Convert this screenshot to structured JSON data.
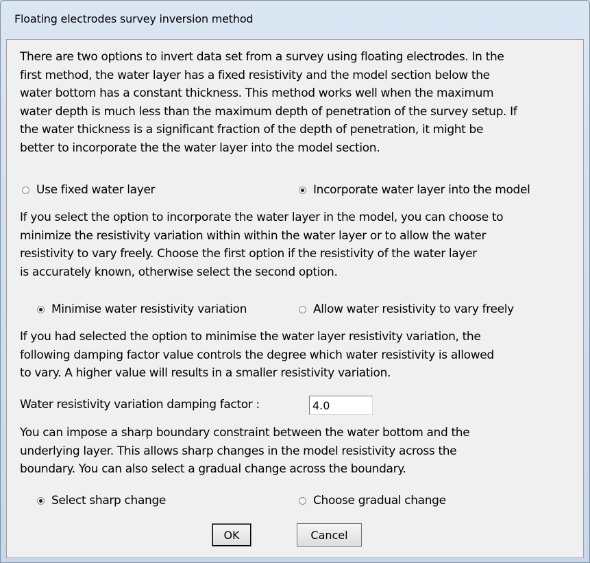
{
  "window": {
    "title": "Floating electrodes survey inversion method"
  },
  "section1": {
    "text": "There are two options to invert data set from a survey using floating electrodes. In the\nfirst method, the water layer has a fixed resistivity and the model section below the\nwater bottom has a constant thickness. This method works well when the maximum\nwater depth is much less than the maximum depth of penetration of the survey setup. If\nthe water thickness is a significant fraction of the depth of penetration, it might be\nbetter to incorporate the the water layer into the model section.",
    "option_fixed": {
      "label": "Use fixed water layer",
      "checked": false
    },
    "option_incorporate": {
      "label": "Incorporate water layer into the model",
      "checked": true
    }
  },
  "section2": {
    "text": "If you select the option to incorporate the water layer in the model, you can choose to\nminimize the resistivity variation within within the water layer or to allow the water\nresistivity to vary freely. Choose the first option if the resistivity of the water layer\nis accurately known, otherwise select the second option.",
    "option_minimise": {
      "label": "Minimise water resistivity variation",
      "checked": true
    },
    "option_free": {
      "label": "Allow water resistivity to vary freely",
      "checked": false
    }
  },
  "section3": {
    "text": "If you had selected the option to minimise the water layer resistivity variation, the\nfollowing damping factor value controls the degree which water resistivity is allowed\nto vary. A higher value will results in a smaller resistivity variation.",
    "damping_label": "Water resistivity variation damping factor :",
    "damping_value": "4.0"
  },
  "section4": {
    "text": "You can impose a sharp boundary constraint between the water bottom and the\nunderlying layer. This allows sharp changes in the model resistivity across the\nboundary. You can also select a gradual change across the boundary.",
    "option_sharp": {
      "label": "Select sharp change",
      "checked": true
    },
    "option_gradual": {
      "label": "Choose gradual change",
      "checked": false
    }
  },
  "buttons": {
    "ok": "OK",
    "cancel": "Cancel"
  }
}
